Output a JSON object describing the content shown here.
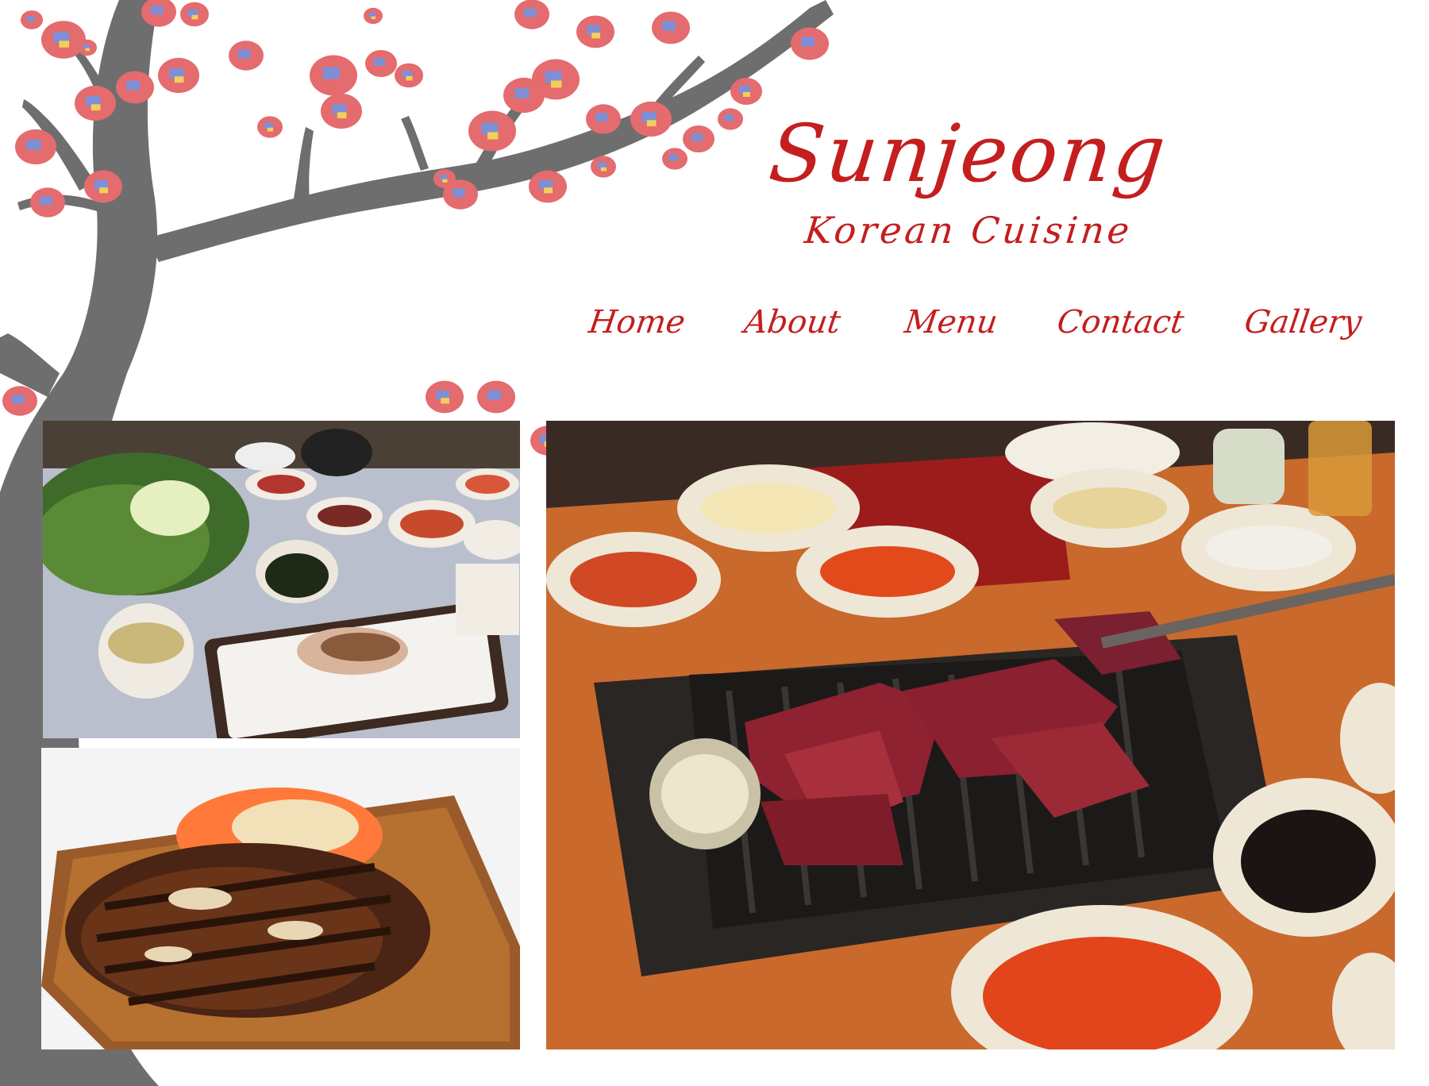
{
  "site": {
    "name": "Sunjeong",
    "tagline": "Korean Cuisine"
  },
  "nav": {
    "items": [
      {
        "label": "Home"
      },
      {
        "label": "About"
      },
      {
        "label": "Menu"
      },
      {
        "label": "Contact"
      },
      {
        "label": "Gallery"
      }
    ]
  },
  "colors": {
    "brand_red": "#c41e1e",
    "tree_gray": "#6e6e6e",
    "blossom_pink": "#e46b6e",
    "blossom_blue": "#7f8fd6",
    "blossom_yellow": "#f2cf5a"
  },
  "images": {
    "banchan_table": "photo of side dishes and sliced pork on a table",
    "galbi_plate": "photo of grilled short ribs on a wooden plate",
    "bbq_grill": "photo of beef on a tabletop grill surrounded by side dishes"
  }
}
